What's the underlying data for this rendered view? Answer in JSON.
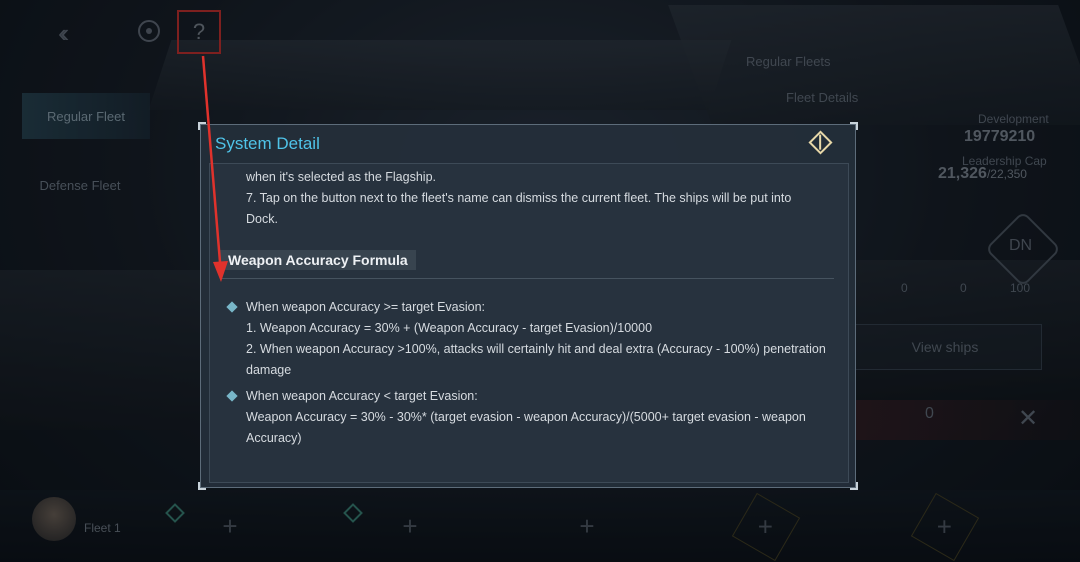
{
  "topbar": {
    "back_icon": "double-chevron-left-icon",
    "target_icon": "target-icon",
    "help_label": "?"
  },
  "tabs": [
    {
      "label": "Regular Fleet"
    },
    {
      "label": "Defense Fleet"
    }
  ],
  "right_panel": {
    "regular_fleets": "Regular Fleets",
    "fleet_details": "Fleet Details",
    "development_label": "Development",
    "development_value": "19779210",
    "leadership_label": "Leadership Cap",
    "leadership_value": "21,326",
    "leadership_max": "/22,350",
    "dn_label": "DN",
    "stats": [
      "0",
      "0",
      "100"
    ],
    "view_ships": "View ships",
    "power_value": "0"
  },
  "bottom": {
    "fleet_name": "Fleet 1",
    "plus": "+"
  },
  "dialog": {
    "title": "System Detail",
    "line1": "when it's selected as the Flagship.",
    "line2": "7. Tap on the button next to the fleet's name can dismiss the current fleet. The ships will be put into Dock.",
    "section_title": "Weapon Accuracy Formula",
    "bullet1_head": "When weapon Accuracy >= target Evasion:",
    "bullet1_line1": "1. Weapon Accuracy = 30% + (Weapon Accuracy - target Evasion)/10000",
    "bullet1_line2": "2. When weapon Accuracy >100%, attacks will certainly hit and deal extra (Accuracy - 100%) penetration damage",
    "bullet2_head": "When weapon Accuracy < target Evasion:",
    "bullet2_line1": "Weapon Accuracy = 30% - 30%* (target evasion - weapon Accuracy)/(5000+  target evasion - weapon Accuracy)"
  },
  "colors": {
    "title": "#4fc3e8",
    "annotation": "#e0322c",
    "bullet": "#78b6c8"
  }
}
